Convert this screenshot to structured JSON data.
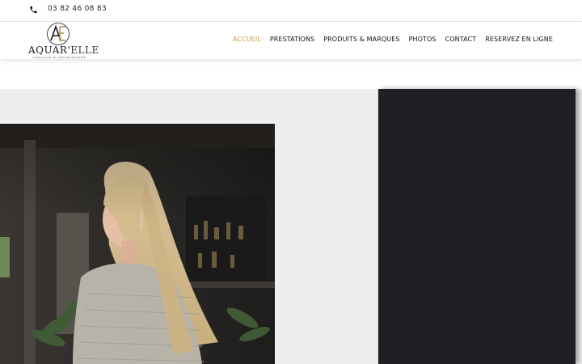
{
  "topbar": {
    "phone_icon": "phone-icon",
    "phone_number": "03 82 46 08 83"
  },
  "brand": {
    "monogram": "AE",
    "name_part1": "AQUAR'",
    "name_part2": "ELLE",
    "tagline": "VOTRE SALON DE COIFFURE BIEN-ÊTRE"
  },
  "nav": {
    "items": [
      {
        "label": "ACCUEIL",
        "active": true
      },
      {
        "label": "PRESTATIONS",
        "active": false
      },
      {
        "label": "PRODUITS & MARQUES",
        "active": false
      },
      {
        "label": "PHOTOS",
        "active": false
      },
      {
        "label": "CONTACT",
        "active": false
      },
      {
        "label": "RESERVEZ EN LIGNE",
        "active": false
      }
    ]
  },
  "colors": {
    "accent": "#c9a04a",
    "band_background": "#efedee",
    "dark_panel": "#1f2024"
  }
}
